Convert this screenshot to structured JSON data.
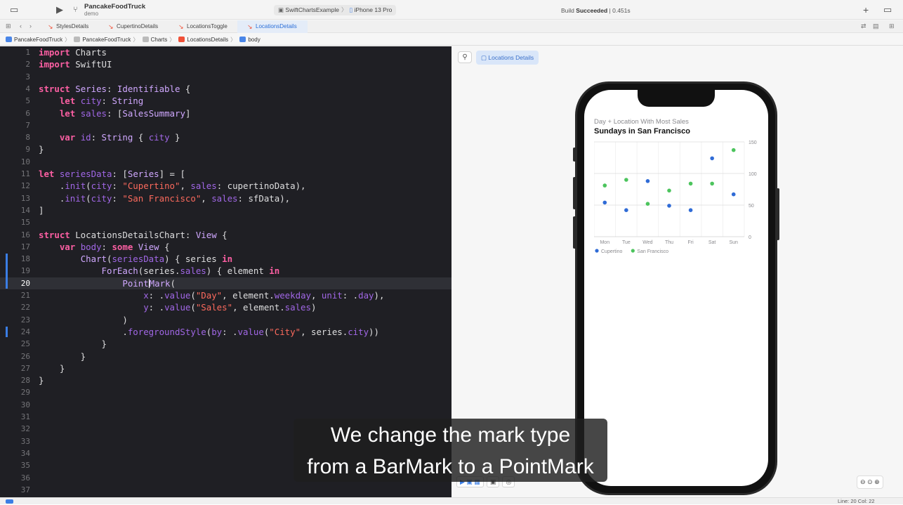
{
  "toolbar": {
    "project_name": "PancakeFoodTruck",
    "project_sub": "demo",
    "scheme": "SwiftChartsExample",
    "device": "iPhone 13 Pro",
    "build_status_prefix": "Build",
    "build_status": "Succeeded",
    "build_time": "0.451s"
  },
  "tabs": [
    {
      "label": "StylesDetails"
    },
    {
      "label": "CupertinoDetails"
    },
    {
      "label": "LocationsToggle"
    },
    {
      "label": "LocationsDetails"
    }
  ],
  "breadcrumb": [
    "PancakeFoodTruck",
    "PancakeFoodTruck",
    "Charts",
    "LocationsDetails",
    "body"
  ],
  "editor": {
    "lines": [
      "import Charts",
      "import SwiftUI",
      "",
      "struct Series: Identifiable {",
      "    let city: String",
      "    let sales: [SalesSummary]",
      "",
      "    var id: String { city }",
      "}",
      "",
      "let seriesData: [Series] = [",
      "    .init(city: \"Cupertino\", sales: cupertinoData),",
      "    .init(city: \"San Francisco\", sales: sfData),",
      "]",
      "",
      "struct LocationsDetailsChart: View {",
      "    var body: some View {",
      "        Chart(seriesData) { series in",
      "            ForEach(series.sales) { element in",
      "                PointMark(",
      "                    x: .value(\"Day\", element.weekday, unit: .day),",
      "                    y: .value(\"Sales\", element.sales)",
      "                )",
      "                .foregroundStyle(by: .value(\"City\", series.city))",
      "            }",
      "        }",
      "    }",
      "}",
      "",
      "",
      "",
      "",
      "",
      "",
      "",
      "",
      ""
    ],
    "highlighted_line": 20
  },
  "preview": {
    "pin_icon": "pin-icon",
    "locations_button": "Locations Details"
  },
  "chart": {
    "subtitle": "Day + Location With Most Sales",
    "title": "Sundays in San Francisco"
  },
  "chart_data": {
    "type": "scatter",
    "categories": [
      "Mon",
      "Tue",
      "Wed",
      "Thu",
      "Fri",
      "Sat",
      "Sun"
    ],
    "series": [
      {
        "name": "Cupertino",
        "color": "#2f6bd6",
        "values": [
          54,
          42,
          88,
          49,
          42,
          124,
          67
        ]
      },
      {
        "name": "San Francisco",
        "color": "#4cc45d",
        "values": [
          81,
          90,
          52,
          73,
          84,
          84,
          137
        ]
      }
    ],
    "yticks": [
      0,
      50,
      100,
      150
    ],
    "ylim": [
      0,
      150
    ],
    "legend_position": "bottom-left",
    "grid": true
  },
  "status_bar": {
    "position": "Line: 20  Col: 22"
  },
  "caption": {
    "line1": "We change the mark type",
    "line2": "from a BarMark to a PointMark"
  }
}
